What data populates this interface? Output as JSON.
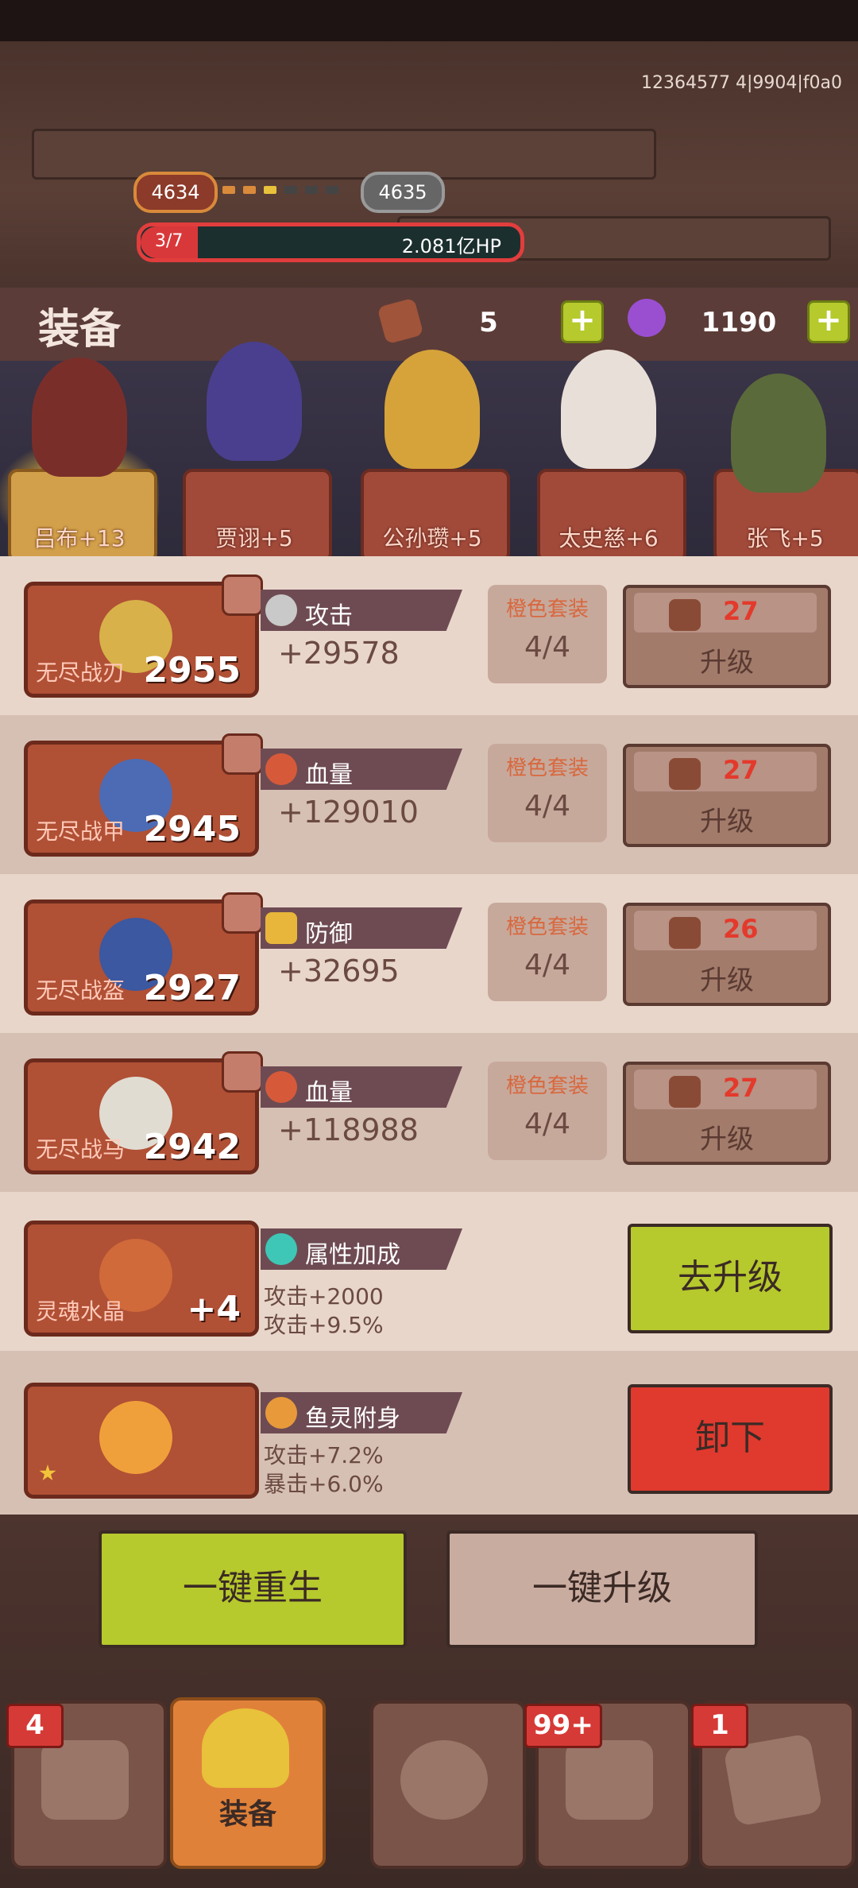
{
  "top": {
    "uid_text": "12364577 4|9904|f0a0",
    "stage_current": "4634",
    "stage_next": "4635",
    "boss_hp_count": "3/7",
    "boss_hp_fraction": 0.15,
    "boss_hp_value": "2.081亿HP"
  },
  "header": {
    "title": "装备",
    "resource1_value": "5",
    "resource2_value": "1190",
    "resource1_icon": "rune-stone-icon",
    "resource2_icon": "purple-gem-icon",
    "plus_icon": "plus-icon"
  },
  "heroes": [
    {
      "name": "吕布+13",
      "selected": true
    },
    {
      "name": "贾诩+5",
      "selected": false
    },
    {
      "name": "公孙瓒+5",
      "selected": false
    },
    {
      "name": "太史慈+6",
      "selected": false
    },
    {
      "name": "张飞+5",
      "selected": false
    }
  ],
  "equipment": [
    {
      "name": "无尽战刃",
      "level": "2955",
      "stat_icon": "sword-icon",
      "stat_label": "攻击",
      "stat_value": "+29578",
      "set_label": "橙色套装",
      "set_value": "4/4",
      "upgrade_cost": "27",
      "upgrade_label": "升级"
    },
    {
      "name": "无尽战甲",
      "level": "2945",
      "stat_icon": "blood-drop-icon",
      "stat_label": "血量",
      "stat_value": "+129010",
      "set_label": "橙色套装",
      "set_value": "4/4",
      "upgrade_cost": "27",
      "upgrade_label": "升级"
    },
    {
      "name": "无尽战盔",
      "level": "2927",
      "stat_icon": "shield-icon",
      "stat_label": "防御",
      "stat_value": "+32695",
      "set_label": "橙色套装",
      "set_value": "4/4",
      "upgrade_cost": "26",
      "upgrade_label": "升级"
    },
    {
      "name": "无尽战马",
      "level": "2942",
      "stat_icon": "blood-drop-icon",
      "stat_label": "血量",
      "stat_value": "+118988",
      "set_label": "橙色套装",
      "set_value": "4/4",
      "upgrade_cost": "27",
      "upgrade_label": "升级"
    }
  ],
  "soul_crystal": {
    "name": "灵魂水晶",
    "level": "+4",
    "stat_label": "属性加成",
    "lines": [
      "攻击+2000",
      "攻击+9.5%"
    ],
    "button": "去升级"
  },
  "fish": {
    "stat_label": "鱼灵附身",
    "lines": [
      "攻击+7.2%",
      "暴击+6.0%"
    ],
    "button": "卸下"
  },
  "actions": {
    "rebirth": "一键重生",
    "upgrade_all": "一键升级"
  },
  "nav": [
    {
      "icon": "shield-warrior-icon",
      "badge": "4",
      "label": ""
    },
    {
      "icon": "armor-icon",
      "badge": "",
      "label": "装备",
      "active": true
    },
    {
      "icon": "helmet-icon",
      "badge": "",
      "label": ""
    },
    {
      "icon": "chest-icon",
      "badge": "99+",
      "label": ""
    },
    {
      "icon": "scroll-icon",
      "badge": "1",
      "label": ""
    }
  ],
  "colors": {
    "accent_green": "#b6c92d",
    "accent_red": "#e0392e",
    "card_red": "#b05035"
  }
}
